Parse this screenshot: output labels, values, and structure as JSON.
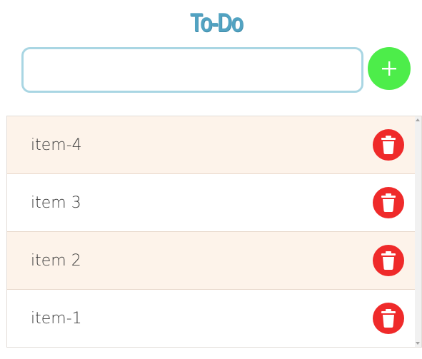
{
  "header": {
    "title": "To-Do"
  },
  "input": {
    "value": "",
    "placeholder": ""
  },
  "add_button": {
    "label": "+",
    "icon": "plus-icon",
    "color": "#4ded4a"
  },
  "delete_button": {
    "icon": "trash-icon",
    "color": "#ef2a2a"
  },
  "items": [
    {
      "text": "item-4"
    },
    {
      "text": "item 3"
    },
    {
      "text": "item 2"
    },
    {
      "text": "item-1"
    }
  ],
  "colors": {
    "title": "#52a3c2",
    "input_border": "#a9d6e3",
    "row_alt": "#fdf3ea"
  }
}
